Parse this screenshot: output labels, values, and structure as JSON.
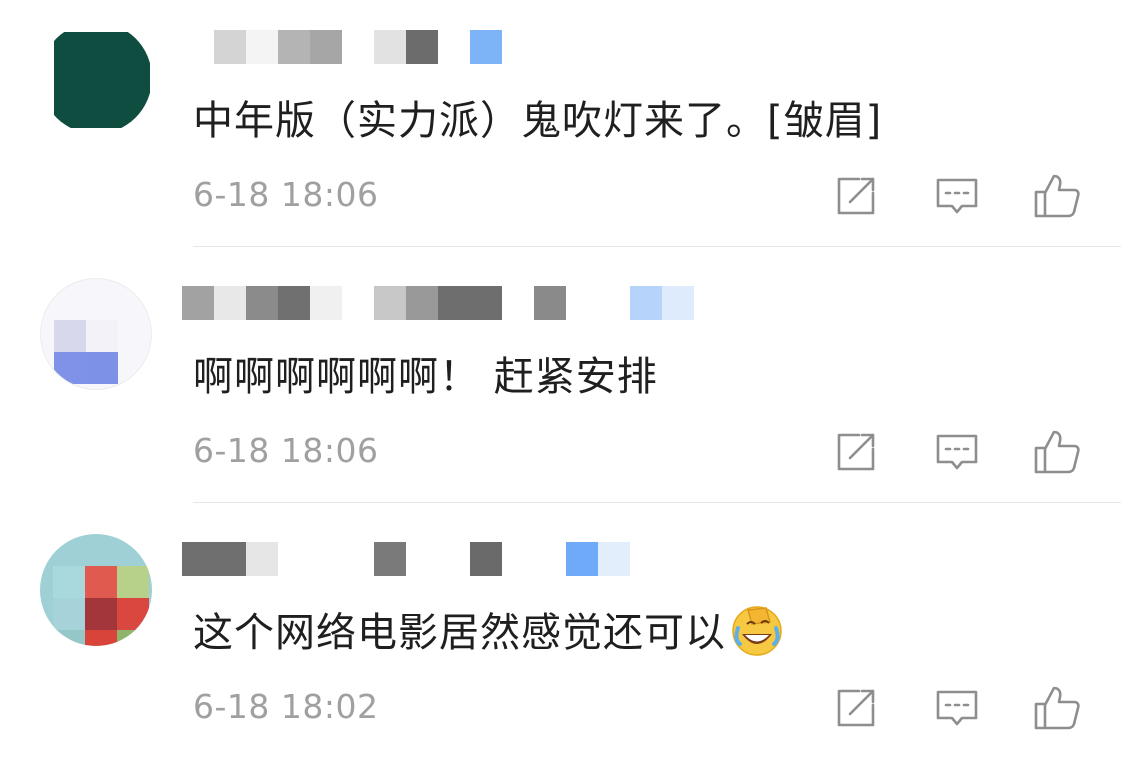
{
  "comments": [
    {
      "text": "中年版（实力派）鬼吹灯来了。[皱眉]",
      "time": "6-18 18:06",
      "has_emoji": false
    },
    {
      "text": "啊啊啊啊啊啊！ 赶紧安排",
      "time": "6-18 18:06",
      "has_emoji": false
    },
    {
      "text": "这个网络电影居然感觉还可以",
      "time": "6-18 18:02",
      "has_emoji": true
    }
  ],
  "icons": {
    "edit": "edit-icon",
    "reply": "comment-icon",
    "like": "thumbs-up-icon",
    "emoji": "facepalm-laugh-emoji-icon"
  },
  "colors": {
    "timestamp": "#a0a0a0",
    "icon_stroke": "#8e8e8e",
    "divider": "#e6e6e6",
    "avatar_1": "#0e4d3f",
    "blurred_name_accent": "#6eaaf7"
  }
}
